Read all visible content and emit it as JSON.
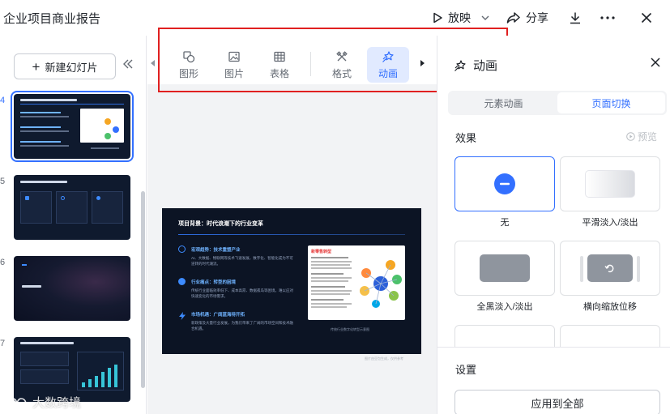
{
  "window": {
    "title": "企业项目商业报告",
    "present_label": "放映",
    "share_label": "分享"
  },
  "left_panel": {
    "new_slide_label": "新建幻灯片",
    "slides": [
      {
        "number": "4",
        "active": true
      },
      {
        "number": "5",
        "active": false
      },
      {
        "number": "6",
        "active": false
      },
      {
        "number": "7",
        "active": false
      }
    ]
  },
  "toolbar": {
    "items": [
      {
        "label": "图形",
        "icon": "shape-icon"
      },
      {
        "label": "图片",
        "icon": "image-icon"
      },
      {
        "label": "表格",
        "icon": "table-icon"
      },
      {
        "label": "格式",
        "icon": "format-brush-icon"
      },
      {
        "label": "动画",
        "icon": "animation-icon",
        "active": true
      }
    ]
  },
  "slide": {
    "title": "项目背景：时代浪潮下的行业变革",
    "bullets": [
      {
        "heading": "宏观趋势：技术重塑产业",
        "body": "AI、大数据、物联网等技术飞速发展，数字化、智能化成为不可逆转的时代潮流。"
      },
      {
        "heading": "行业痛点：转型的困境",
        "body": "传统行业面临效率低下、成本高昂、数据孤岛等困境，难以应对快速变化的市场需求。"
      },
      {
        "heading": "市场机遇：广阔蓝海待开拓",
        "body": "新政策及大量行业发展，为我们带来了广阔的市场空间和技术融合机遇。"
      }
    ],
    "card_title": "新零售转型",
    "caption": "传统行业数字化转型示意图",
    "footer": "图片由豆包生成，仅供参考"
  },
  "right_panel": {
    "title": "动画",
    "tabs": [
      {
        "label": "元素动画",
        "active": false
      },
      {
        "label": "页面切换",
        "active": true
      }
    ],
    "effects_label": "效果",
    "preview_label": "预览",
    "effects": [
      {
        "label": "无",
        "selected": true
      },
      {
        "label": "平滑淡入/淡出",
        "selected": false
      },
      {
        "label": "全黑淡入/淡出",
        "selected": false
      },
      {
        "label": "横向缩放位移",
        "selected": false
      }
    ],
    "settings_label": "设置",
    "apply_all_label": "应用到全部"
  },
  "watermark": "大数跨境",
  "colors": {
    "accent": "#3370ff",
    "highlight_frame": "#e02020",
    "slide_bg": "#0c1424"
  }
}
